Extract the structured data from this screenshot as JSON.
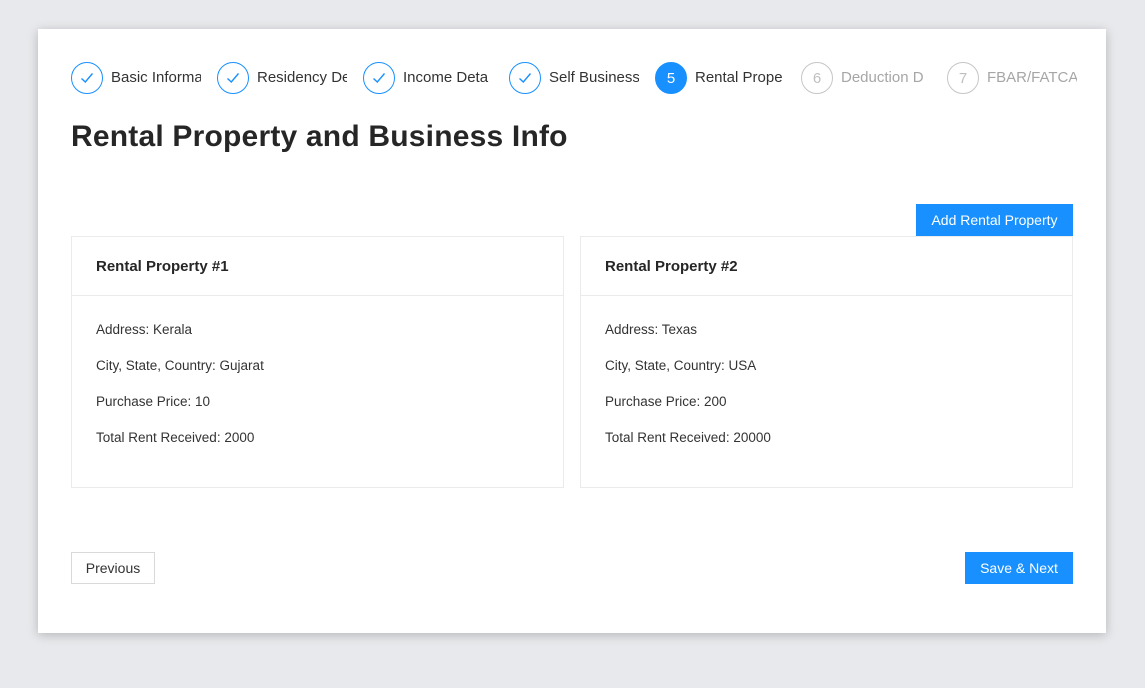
{
  "steps": [
    {
      "status": "done",
      "number": "1",
      "title": "Basic Informa",
      "icon": "check-icon"
    },
    {
      "status": "done",
      "number": "2",
      "title": "Residency De",
      "icon": "check-icon"
    },
    {
      "status": "done",
      "number": "3",
      "title": "Income Deta",
      "icon": "check-icon"
    },
    {
      "status": "done",
      "number": "4",
      "title": "Self Business",
      "icon": "check-icon"
    },
    {
      "status": "active",
      "number": "5",
      "title": "Rental Prope"
    },
    {
      "status": "wait",
      "number": "6",
      "title": "Deduction D"
    },
    {
      "status": "wait",
      "number": "7",
      "title": "FBAR/FATCA"
    }
  ],
  "page": {
    "title": "Rental Property and Business Info"
  },
  "actions": {
    "add_rental_label": "Add Rental Property",
    "previous_label": "Previous",
    "save_next_label": "Save & Next"
  },
  "properties": [
    {
      "title": "Rental Property #1",
      "address": "Address: Kerala",
      "city_state_country": "City, State, Country: Gujarat",
      "purchase_price": "Purchase Price: 10",
      "total_rent": "Total Rent Received: 2000"
    },
    {
      "title": "Rental Property #2",
      "address": "Address: Texas",
      "city_state_country": "City, State, Country: USA",
      "purchase_price": "Purchase Price: 200",
      "total_rent": "Total Rent Received: 20000"
    }
  ],
  "colors": {
    "primary": "#1890ff",
    "background": "#e8e9ec",
    "wait_gray": "#bfbfbf"
  }
}
